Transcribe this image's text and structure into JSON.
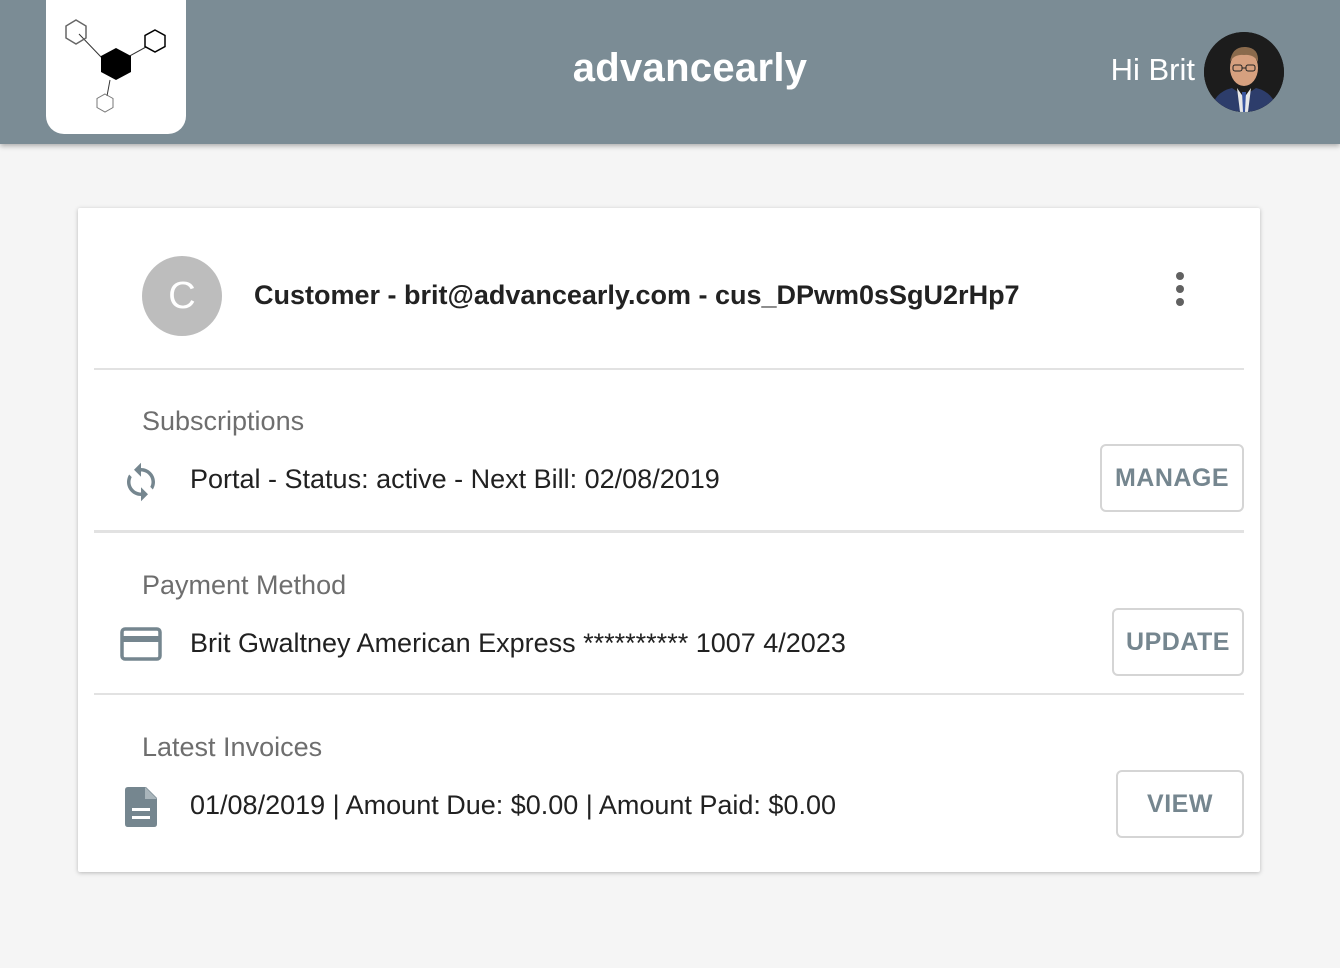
{
  "header": {
    "app_title": "advancearly",
    "greeting": "Hi Brit"
  },
  "customer": {
    "avatar_letter": "C",
    "title": "Customer - brit@advancearly.com - cus_DPwm0sSgU2rHp7"
  },
  "subscriptions": {
    "label": "Subscriptions",
    "item": "Portal - Status: active - Next Bill: 02/08/2019",
    "button": "MANAGE"
  },
  "payment_method": {
    "label": "Payment Method",
    "item": "Brit Gwaltney American Express ********** 1007 4/2023",
    "button": "UPDATE"
  },
  "invoices": {
    "label": "Latest Invoices",
    "item": "01/08/2019 | Amount Due: $0.00 | Amount Paid: $0.00",
    "button": "VIEW"
  },
  "icons": {
    "subscription": "sync-icon",
    "payment": "credit-card-icon",
    "invoice": "document-icon",
    "menu": "more-vert-icon"
  },
  "colors": {
    "appbar": "#7b8c95",
    "accent_button_text": "#75868f",
    "icon": "#75868f"
  }
}
